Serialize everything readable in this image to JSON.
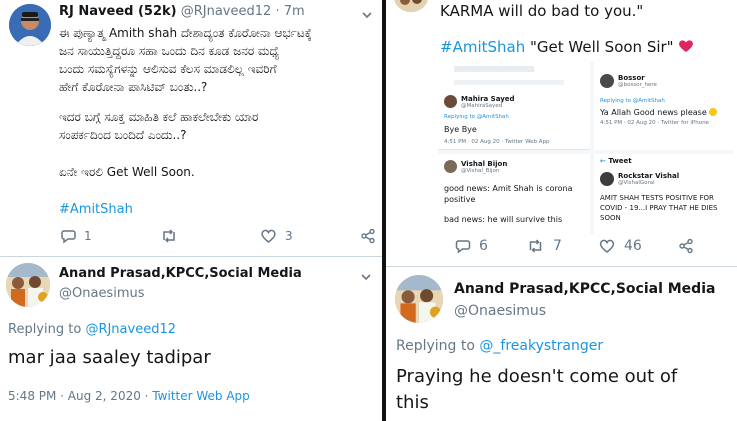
{
  "left": {
    "tweet": {
      "name": "RJ Naveed (52k)",
      "handle": "@RJnaveed12",
      "time": "· 7m",
      "body_lines": [
        "ಈ ಪುಣ್ಯಾತ್ಮ Amith shah ದೇಶಾದ್ಯಂತ ಕೊರೋನಾ ಆರ್ಭಟಕ್ಕೆ",
        "ಜನ ಸಾಯುತ್ತಿದ್ದರೂ ಸಹಾ ಒಂದು ದಿನ ಕೂಡ ಜನರ ಮಧ್ಯೆ",
        "ಬಂದು ಸಮಸ್ಯೆಗಳನ್ನು ಆಲಿಸುವ ಕೆಲಸ ಮಾಡಲಿಲ್ಲ ಇವರಿಗೆ",
        "ಹೇಗೆ ಕೊರೋನಾ ಪಾಸಿಟಿವ್ ಬಂತು..?"
      ],
      "body2_lines": [
        "ಇದರ ಬಗ್ಗೆ ಸೂಕ್ತ ಮಾಹಿತಿ ಕಲೆ ಹಾಕಲೇಬೇಕು ಯಾರ",
        "ಸಂಪರ್ಕದಿಂದ ಬಂದಿದೆ ಎಂದು..?"
      ],
      "body3": "ಏನೇ ಇರಲಿ Get Well Soon.",
      "hashtag": "#AmitShah",
      "reply_count": "1",
      "like_count": "3"
    },
    "reply": {
      "name": "Anand Prasad,KPCC,Social Media",
      "handle": "@Onaesimus",
      "replying_prefix": "Replying to",
      "replying_to": "@RJnaveed12",
      "text": "mar jaa saaley tadipar",
      "timestamp": "5:48 PM · Aug 2, 2020 ·",
      "source": "Twitter Web App"
    }
  },
  "right": {
    "top_text": "KARMA will do bad to you.\"",
    "tweet": {
      "hashtag": "#AmitShah",
      "text": " \"Get Well Soon Sir\" ",
      "reply_count": "6",
      "retweet_count": "7",
      "like_count": "46"
    },
    "mini": {
      "mahira": {
        "name": "Mahira Sayed",
        "handle": "@MahiraSayed",
        "replying_prefix": "Replying to",
        "replying_to": "@AmitShah",
        "text": "Bye Bye",
        "meta": "4:51 PM · 02 Aug 20 · Twitter Web App"
      },
      "bossor": {
        "name": "Bossor",
        "handle": "@bossor_here",
        "replying_prefix": "Replying to",
        "replying_to": "@AmitShah",
        "text": "Ya Allah Good news please",
        "meta": "4:51 PM · 02 Aug 20 · Twitter for iPhone"
      },
      "vishal_bijon": {
        "name": "Vishal Bijon",
        "handle": "@Vishal_Bijon",
        "text1": "good news: Amit Shah is corona",
        "text2": "positive",
        "text3": "bad news: he will survive this"
      },
      "rockstar": {
        "header": "Tweet",
        "name": "Rockstar Vishal",
        "handle": "@VishalGoral",
        "line1": "AMIT SHAH TESTS POSITIVE FOR",
        "line2": "COVID - 19...I PRAY THAT HE DIES",
        "line3": "SOON"
      }
    },
    "reply": {
      "name": "Anand Prasad,KPCC,Social Media",
      "handle": "@Onaesimus",
      "replying_prefix": "Replying to",
      "replying_to": "@_freakystranger",
      "text_line1": "Praying he doesn't come out of",
      "text_line2": "this"
    }
  },
  "colors": {
    "link": "#1b95e0",
    "muted": "#657786",
    "heart": "#e0245e",
    "divider": "#111111"
  }
}
